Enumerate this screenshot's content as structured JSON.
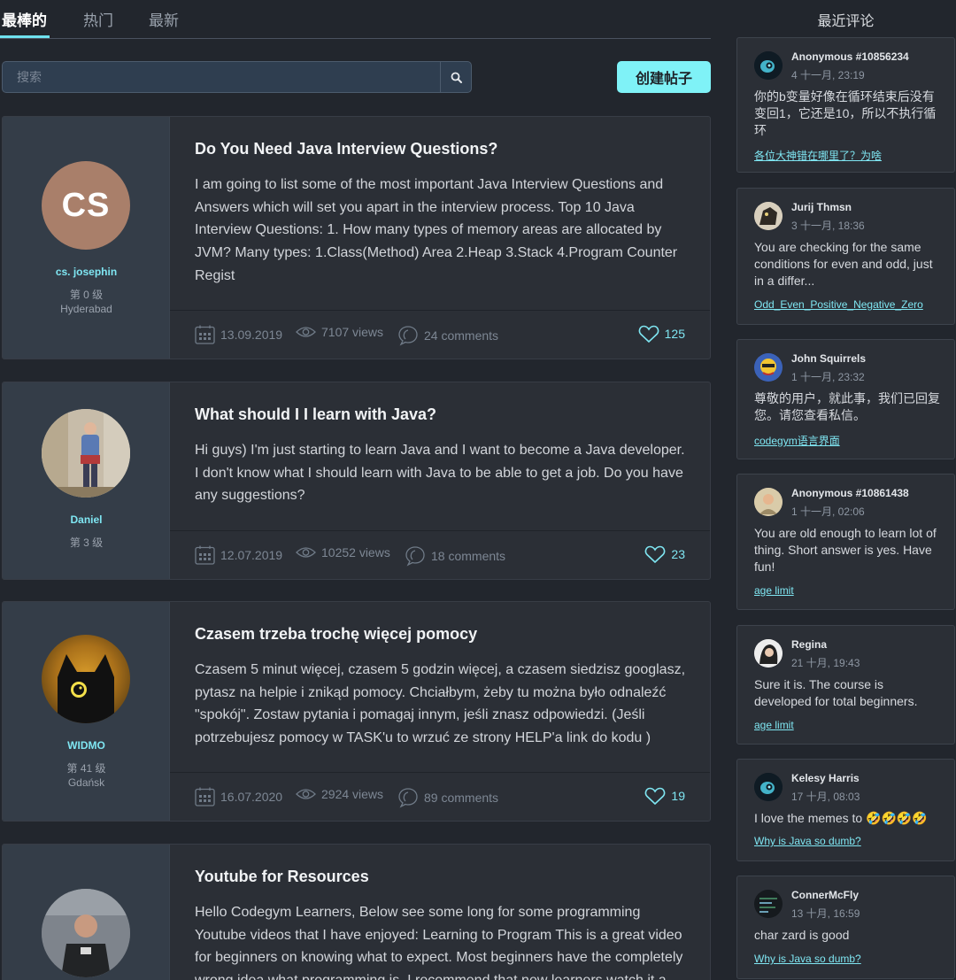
{
  "tabs": [
    {
      "label": "最棒的",
      "active": true
    },
    {
      "label": "热门",
      "active": false
    },
    {
      "label": "最新",
      "active": false
    }
  ],
  "search": {
    "placeholder": "搜索",
    "icon": "search-icon"
  },
  "create_button": "创建帖子",
  "posts": [
    {
      "title": "Do You Need Java Interview Questions?",
      "body": "I am going to list some of the most important Java Interview Questions and Answers which will set you apart in the interview process. Top 10 Java Interview Questions: 1. How many types of memory areas are allocated by JVM? Many types: 1.Class(Method) Area 2.Heap 3.Stack 4.Program Counter Regist",
      "author": {
        "initials": "CS",
        "name": "cs. josephin",
        "level": "第 0 级",
        "city": "Hyderabad"
      },
      "date": "13.09.2019",
      "views": "7107 views",
      "comments": "24 comments",
      "likes": "125"
    },
    {
      "title": "What should I I learn with Java?",
      "body": "Hi guys) I'm just starting to learn Java and I want to become a Java developer. I don't know what I should learn with Java to be able to get a job. Do you have any suggestions?",
      "author": {
        "name": "Daniel",
        "level": "第 3 级"
      },
      "date": "12.07.2019",
      "views": "10252 views",
      "comments": "18 comments",
      "likes": "23"
    },
    {
      "title": "Czasem trzeba trochę więcej pomocy",
      "body": "Czasem 5 minut więcej, czasem 5 godzin więcej, a czasem siedzisz googlasz, pytasz na helpie i znikąd pomocy. Chciałbym, żeby tu można było odnaleźć \"spokój\". Zostaw pytania i pomagaj innym, jeśli znasz odpowiedzi. (Jeśli potrzebujesz pomocy w TASK'u to wrzuć ze strony HELP'a link do kodu )",
      "author": {
        "name": "WIDMO",
        "level": "第 41 级",
        "city": "Gdańsk"
      },
      "date": "16.07.2020",
      "views": "2924 views",
      "comments": "89 comments",
      "likes": "19"
    },
    {
      "title": "Youtube for Resources",
      "body": "Hello Codegym Learners, Below see some long for some programming Youtube videos that I have enjoyed: Learning to Program This is a great video for beginners on knowing what to expect. Most beginners have the completely wrong idea what programming is. I recommend that new learners watch it a"
    }
  ],
  "sidebar": {
    "title": "最近评论",
    "comments": [
      {
        "name": "Anonymous #10856234",
        "date": "4 十一月, 23:19",
        "text": "你的b变量好像在循环结束后没有变回1，它还是10，所以不执行循环",
        "link": "各位大神错在哪里了？为啥"
      },
      {
        "name": "Jurij Thmsn",
        "date": "3 十一月, 18:36",
        "text": "You are checking for the same conditions for even and odd, just in a differ...",
        "link": "Odd_Even_Positive_Negative_Zero"
      },
      {
        "name": "John Squirrels",
        "date": "1 十一月, 23:32",
        "text": "尊敬的用户，就此事，我们已回复您。请您查看私信。",
        "link": "codegym语言界面"
      },
      {
        "name": "Anonymous #10861438",
        "date": "1 十一月, 02:06",
        "text": "You are old enough to learn lot of thing. Short answer is yes. Have fun!",
        "link": "age limit"
      },
      {
        "name": "Regina",
        "date": "21 十月, 19:43",
        "text": "Sure it is. The course is developed for total beginners.",
        "link": "age limit"
      },
      {
        "name": "Kelesy Harris",
        "date": "17 十月, 08:03",
        "text": "I love the memes to 🤣🤣🤣🤣",
        "link": "Why is Java so dumb?"
      },
      {
        "name": "ConnerMcFly",
        "date": "13 十月, 16:59",
        "text": "char zard is good",
        "link": "Why is Java so dumb?"
      }
    ]
  },
  "colors": {
    "accent": "#7ff2f7",
    "background": "#22262d",
    "card": "#2b2f36",
    "author_panel": "#343d48"
  }
}
